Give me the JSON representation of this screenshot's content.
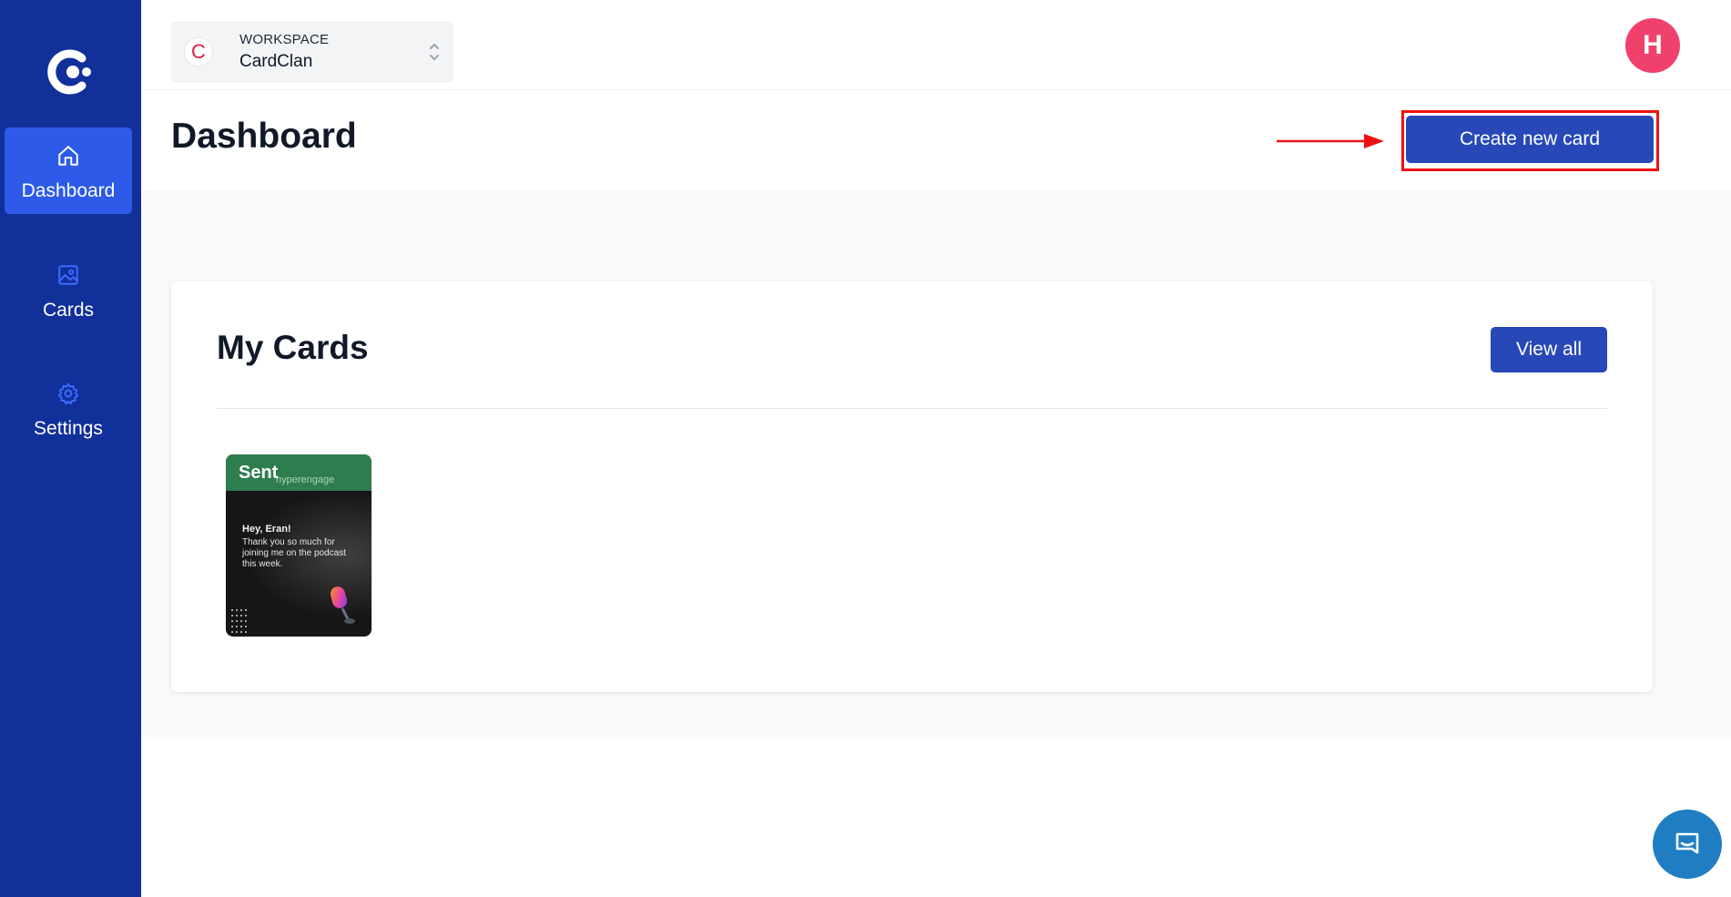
{
  "sidebar": {
    "logo_icon": "cardclan-logo",
    "items": [
      {
        "label": "Dashboard",
        "icon": "home-icon",
        "active": true
      },
      {
        "label": "Cards",
        "icon": "image-icon",
        "active": false
      },
      {
        "label": "Settings",
        "icon": "gear-icon",
        "active": false
      }
    ]
  },
  "topbar": {
    "workspace": {
      "logo_letter": "C",
      "caption": "WORKSPACE",
      "name": "CardClan",
      "icon": "chevron-up-down-icon"
    },
    "avatar_initial": "H"
  },
  "header": {
    "title": "Dashboard",
    "create_label": "Create new card"
  },
  "my_cards": {
    "title": "My Cards",
    "view_all_label": "View all",
    "cards": [
      {
        "status": "Sent",
        "brand": "hyperengage",
        "greeting": "Hey, Eran!",
        "message": "Thank you so much for joining me on the podcast this week."
      }
    ]
  },
  "chat": {
    "icon": "chat-icon"
  },
  "colors": {
    "sidebar": "#11309a",
    "sidebar_active": "#2d5ae9",
    "primary_button": "#2848b8",
    "avatar": "#f0416c",
    "annotation": "#ee1111",
    "sent_badge": "#2e7d4f",
    "chat_launcher": "#1f7ec2"
  }
}
